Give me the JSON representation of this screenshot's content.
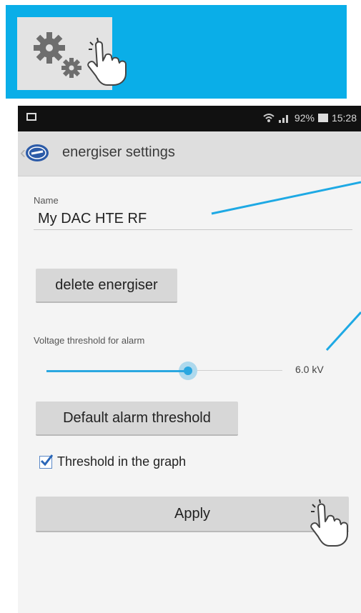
{
  "status_bar": {
    "battery": "92%",
    "time": "15:28"
  },
  "app_bar": {
    "title": "energiser settings",
    "logo_icon": "energiser-brand-logo-icon"
  },
  "form": {
    "name_label": "Name",
    "name_value": "My DAC HTE RF",
    "delete_button": "delete energiser",
    "threshold_label": "Voltage threshold for alarm",
    "threshold_value": "6.0 kV",
    "threshold_slider_fraction": 0.6,
    "default_button": "Default alarm threshold",
    "graph_checkbox_label": "Threshold in the graph",
    "graph_checkbox_checked": true,
    "apply_button": "Apply"
  },
  "colors": {
    "banner": "#0aaee8",
    "accent": "#2aa7e0",
    "callout_line": "#1ea9e4"
  },
  "icons": [
    "gears-icon",
    "hand-pointer-icon",
    "wifi-icon",
    "signal-icon",
    "battery-icon",
    "back-chevron-icon",
    "checkmark-icon"
  ]
}
